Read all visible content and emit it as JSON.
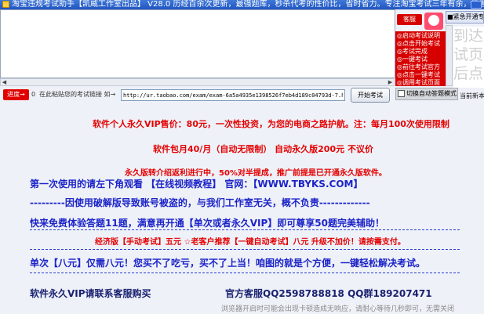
{
  "window": {
    "title": "淘宝违规考试助手【凯威工作室出品】 V28.0   历经百余次更新，最强题库，秒杀代考的性价比，省时省力。专注淘宝考试三年有余，信誉保证，请放心使用。"
  },
  "top_panel": {
    "ad_button_label": "客服QQ→",
    "urgent_label": "■紧急开通专",
    "notice_lines": [
      "◎启动考试说明",
      "◎点击开始考试",
      "◎考试完成",
      "◎一键考试",
      "◎前往考试官方",
      "◎点击一键考试",
      "◎调用考试页面"
    ],
    "ghost_text": [
      "到达",
      "试页",
      "后点"
    ]
  },
  "toolbar": {
    "progress_label": "进度→",
    "zero_value": "0",
    "paste_hint": "在此粘贴您的考试链接 如→",
    "url_value": "http://ur.taobao.com/exam/exam-6a5a4935e1398526f7eb4d189c04793d-7.htm",
    "start_button": "开始考试",
    "auto_toggle_label": "切换自动答题模式",
    "current_label": "当前新本"
  },
  "content": {
    "price_line": "软件个人永久VIP售价：80元，一次性投资，为您的电商之路护航。注：每月100次使用限制",
    "monthly_line": "软件包月40/月（自动无限制）   自动永久版200元 不议价",
    "rebate_line": "永久版转介绍返利进行中，50%对半提成，推广前提是已开通永久版软件。",
    "first_use_line": "第一次使用的请左下角观看  【在线视频教程】   官网：【WWW.TBYKS.COM】",
    "piracy_line": "---------因使用破解版导致账号被盗的，与我们工作室无关，概不负责-------------",
    "free_trial_line": "快来免费体验答题11题，满意再开通【单次或者永久VIP】即可尊享50题完美辅助！",
    "economy_line": "经济版【手动考试】五元  ☆老客户推荐【一键自动考试】八元 升级不加价！请按需支付。",
    "single_line": "单次【八元】仅需八元！您买不了吃亏，买不了上当！咱图的就是个方便，一键轻松解决考试。",
    "contact_line": "软件永久VIP请联系客服购买",
    "qq_line": "官方客服QQ2598788818   QQ群189207471",
    "footer_tip": "浏览器开启时可能会出现卡顿造成无响应，请耐心等待几秒即可，无需关闭"
  },
  "colors": {
    "title_bar": "#1f55c1",
    "red_text": "#e40000",
    "blue_text": "#1c24c8",
    "background": "#eef1f8"
  }
}
